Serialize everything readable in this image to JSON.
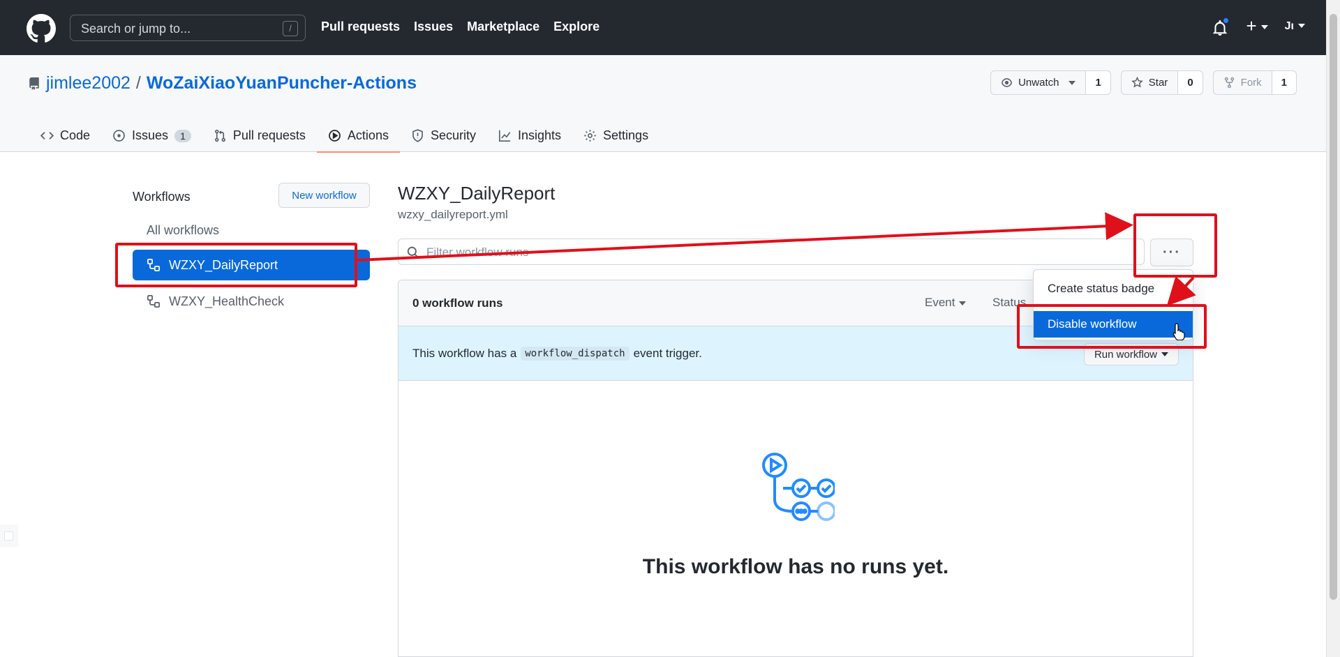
{
  "header": {
    "search_placeholder": "Search or jump to...",
    "search_shortcut": "/",
    "nav": [
      "Pull requests",
      "Issues",
      "Marketplace",
      "Explore"
    ],
    "avatar_text": "Jι"
  },
  "repo": {
    "owner": "jimlee2002",
    "separator": "/",
    "name": "WoZaiXiaoYuanPuncher-Actions",
    "unwatch_label": "Unwatch",
    "unwatch_count": "1",
    "star_label": "Star",
    "star_count": "0",
    "fork_label": "Fork",
    "fork_count": "1"
  },
  "tabs": {
    "code": "Code",
    "issues": "Issues",
    "issues_count": "1",
    "pulls": "Pull requests",
    "actions": "Actions",
    "security": "Security",
    "insights": "Insights",
    "settings": "Settings"
  },
  "sidebar": {
    "title": "Workflows",
    "new_workflow": "New workflow",
    "all": "All workflows",
    "items": [
      "WZXY_DailyReport",
      "WZXY_HealthCheck"
    ]
  },
  "main": {
    "title": "WZXY_DailyReport",
    "file": "wzxy_dailyreport.yml",
    "filter_placeholder": "Filter workflow runs",
    "kebab": "···",
    "runs_count": "0 workflow runs",
    "event_filter": "Event",
    "status_filter": "Status",
    "dispatch_before": "This workflow has a",
    "dispatch_code": "workflow_dispatch",
    "dispatch_after": "event trigger.",
    "run_workflow": "Run workflow",
    "empty_title": "This workflow has no runs yet."
  },
  "dropdown": {
    "create_badge": "Create status badge",
    "disable": "Disable workflow"
  },
  "colors": {
    "header_bg": "#24292f",
    "accent": "#0969da",
    "annotation": "#e0101a",
    "tab_underline": "#fd8c73"
  }
}
